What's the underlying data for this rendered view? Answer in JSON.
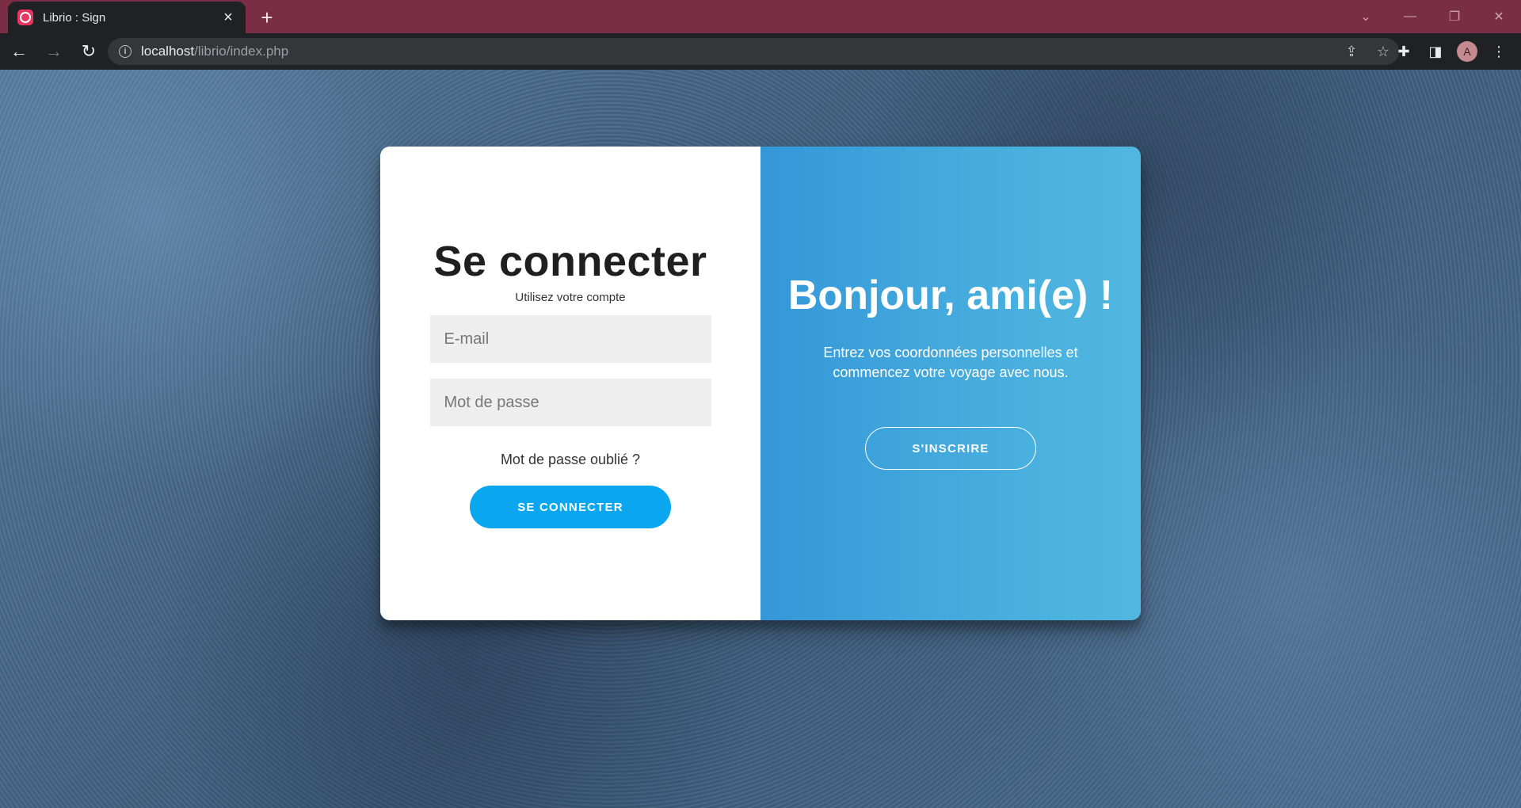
{
  "browser": {
    "tab_title": "Librio : Sign",
    "tab_close": "×",
    "new_tab": "+",
    "url_host": "localhost",
    "url_path": "/librio/index.php",
    "avatar_letter": "A"
  },
  "login": {
    "title": "Se connecter",
    "subtitle": "Utilisez votre compte",
    "email_placeholder": "E-mail",
    "password_placeholder": "Mot de passe",
    "forgot_label": "Mot de passe oublié ?",
    "submit_label": "SE CONNECTER"
  },
  "signup": {
    "title": "Bonjour, ami(e) !",
    "text": "Entrez vos coordonnées personnelles et commencez votre voyage avec nous.",
    "button_label": "S'INSCRIRE"
  },
  "colors": {
    "title_bar": "#7a2e45",
    "primary_button": "#0aa6f0",
    "panel_gradient_start": "#3497d8",
    "panel_gradient_end": "#52b8e0"
  }
}
